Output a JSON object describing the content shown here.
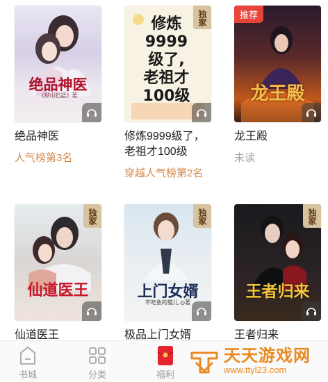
{
  "books": [
    {
      "title": "绝品神医",
      "cover_title": "绝品神医",
      "cover_author": "《默山石語》著",
      "rank": "人气榜第3名",
      "rank_style": "hot",
      "badge": "",
      "recommended": false
    },
    {
      "title": "修炼9999级了，老祖才100级",
      "cover_title": "修炼9999级了,老祖才100级",
      "cover_author": "",
      "rank": "穿越人气榜第2名",
      "rank_style": "hot",
      "badge": "独家",
      "recommended": false
    },
    {
      "title": "龙王殿",
      "cover_title": "龙王殿",
      "cover_author": "",
      "rank": "未读",
      "rank_style": "unread",
      "badge": "",
      "recommended": true,
      "recommended_label": "推荐"
    },
    {
      "title": "仙道医王",
      "cover_title": "仙道医王",
      "cover_author": "",
      "rank": "",
      "badge": "独家",
      "recommended": false
    },
    {
      "title": "极品上门女婿",
      "cover_title": "上门女婿",
      "cover_author": "不吃鱼的猫儿 ◎著",
      "rank": "",
      "badge": "独家",
      "recommended": false
    },
    {
      "title": "王者归来",
      "cover_title": "王者归来",
      "cover_author": "",
      "rank": "",
      "badge": "独家",
      "recommended": false
    }
  ],
  "tabs": [
    {
      "label": "书城",
      "icon": "bookstore-icon"
    },
    {
      "label": "分类",
      "icon": "category-grid-icon"
    },
    {
      "label": "福利",
      "icon": "red-envelope-icon"
    }
  ],
  "watermark": {
    "name": "天天游戏网",
    "url": "www.ttyl23.com"
  },
  "colors": {
    "accent_rank": "#d4884a",
    "unread": "#a3a3a3",
    "badge_bg": "#d8c3a1",
    "recommend_bg": "#e8443a"
  }
}
